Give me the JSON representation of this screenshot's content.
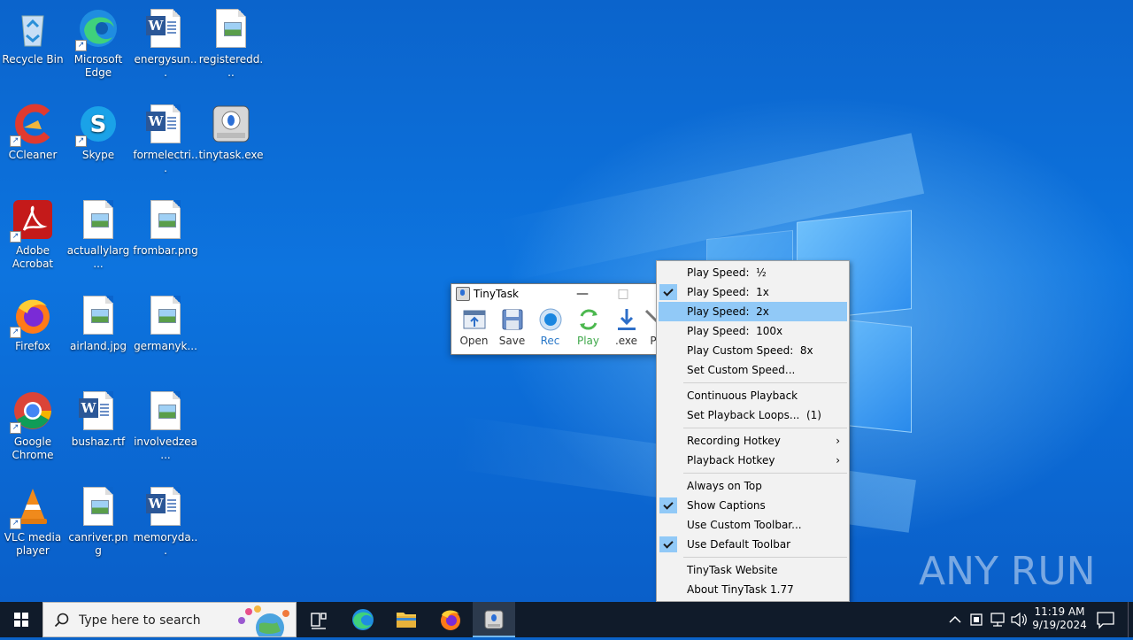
{
  "desktop_icons": [
    {
      "label": "Recycle Bin",
      "icon": "recycle-bin-icon"
    },
    {
      "label": "Microsoft Edge",
      "icon": "edge-icon"
    },
    {
      "label": "energysun...",
      "icon": "word-doc-icon"
    },
    {
      "label": "registeredd...",
      "icon": "image-file-icon"
    },
    {
      "label": "CCleaner",
      "icon": "ccleaner-icon"
    },
    {
      "label": "Skype",
      "icon": "skype-icon"
    },
    {
      "label": "formelectri...",
      "icon": "word-doc-icon"
    },
    {
      "label": "tinytask.exe",
      "icon": "tinytask-icon"
    },
    {
      "label": "Adobe Acrobat",
      "icon": "acrobat-icon"
    },
    {
      "label": "actuallylarg...",
      "icon": "image-file-icon"
    },
    {
      "label": "frombar.png",
      "icon": "image-file-icon"
    },
    {
      "label": "Firefox",
      "icon": "firefox-icon"
    },
    {
      "label": "airland.jpg",
      "icon": "image-file-icon"
    },
    {
      "label": "germanyk...",
      "icon": "image-file-icon"
    },
    {
      "label": "Google Chrome",
      "icon": "chrome-icon"
    },
    {
      "label": "bushaz.rtf",
      "icon": "word-doc-icon"
    },
    {
      "label": "involvedzea...",
      "icon": "image-file-icon"
    },
    {
      "label": "VLC media player",
      "icon": "vlc-icon"
    },
    {
      "label": "canriver.png",
      "icon": "image-file-icon"
    },
    {
      "label": "memoryda...",
      "icon": "word-doc-icon"
    }
  ],
  "tinytask": {
    "title": "TinyTask",
    "minimize": "—",
    "maximize": "□",
    "tools": [
      {
        "label": "Open",
        "icon": "open-icon"
      },
      {
        "label": "Save",
        "icon": "save-icon"
      },
      {
        "label": "Rec",
        "icon": "record-icon"
      },
      {
        "label": "Play",
        "icon": "play-icon"
      },
      {
        "label": ".exe",
        "icon": "compile-exe-icon"
      },
      {
        "label": "P",
        "icon": "prefs-icon"
      }
    ]
  },
  "menu": {
    "items": [
      {
        "label": "Play Speed:  ½",
        "checked": false
      },
      {
        "label": "Play Speed:  1x",
        "checked": true
      },
      {
        "label": "Play Speed:  2x",
        "checked": false,
        "highlighted": true
      },
      {
        "label": "Play Speed:  100x",
        "checked": false
      },
      {
        "label": "Play Custom Speed:  8x",
        "checked": false
      },
      {
        "label": "Set Custom Speed...",
        "checked": false
      },
      {
        "label": "Continuous Playback",
        "checked": false
      },
      {
        "label": "Set Playback Loops...  (1)",
        "checked": false
      },
      {
        "label": "Recording Hotkey",
        "submenu": true
      },
      {
        "label": "Playback Hotkey",
        "submenu": true
      },
      {
        "label": "Always on Top",
        "checked": false
      },
      {
        "label": "Show Captions",
        "checked": true
      },
      {
        "label": "Use Custom Toolbar...",
        "checked": false
      },
      {
        "label": "Use Default Toolbar",
        "checked": true
      },
      {
        "label": "TinyTask Website",
        "checked": false
      },
      {
        "label": "About TinyTask 1.77",
        "checked": false
      }
    ],
    "submenu_arrow": "›"
  },
  "taskbar": {
    "search_placeholder": "Type here to search",
    "clock_time": "11:19 AM",
    "clock_date": "9/19/2024"
  },
  "watermark": "ANY RUN",
  "colors": {
    "desktop": "#0b64cc",
    "taskbar": "#101b2a",
    "menu_highlight": "#91c9f7",
    "word_blue": "#2b5797"
  }
}
